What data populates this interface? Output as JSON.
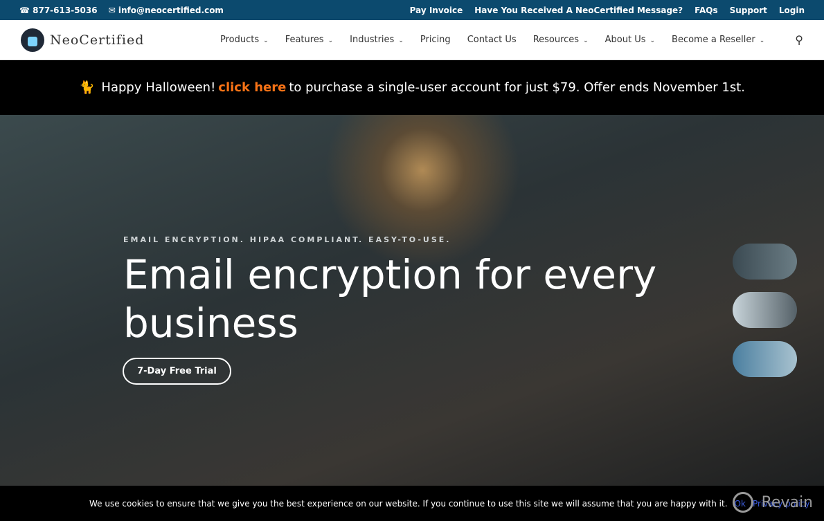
{
  "topbar": {
    "phone": "877-613-5036",
    "email": "info@neocertified.com",
    "links": [
      "Pay Invoice",
      "Have You Received A NeoCertified Message?",
      "FAQs",
      "Support",
      "Login"
    ]
  },
  "logo": {
    "text": "NeoCertified"
  },
  "nav": {
    "items": [
      {
        "label": "Products",
        "dropdown": true
      },
      {
        "label": "Features",
        "dropdown": true
      },
      {
        "label": "Industries",
        "dropdown": true
      },
      {
        "label": "Pricing",
        "dropdown": false
      },
      {
        "label": "Contact Us",
        "dropdown": false
      },
      {
        "label": "Resources",
        "dropdown": true
      },
      {
        "label": "About Us",
        "dropdown": true
      },
      {
        "label": "Become a Reseller",
        "dropdown": true
      }
    ]
  },
  "promo": {
    "before": "Happy Halloween!",
    "link": "click here",
    "after": "to purchase a single-user account for just $79. Offer ends November 1st."
  },
  "hero": {
    "eyebrow": "EMAIL ENCRYPTION. HIPAA COMPLIANT. EASY-TO-USE.",
    "title": "Email encryption for every business",
    "cta": "7-Day Free Trial"
  },
  "cookie": {
    "text": "We use cookies to ensure that we give you the best experience on our website. If you continue to use this site we will assume that you are happy with it.",
    "ok": "Ok",
    "privacy": "Privacy policy"
  },
  "watermark": "Revain"
}
